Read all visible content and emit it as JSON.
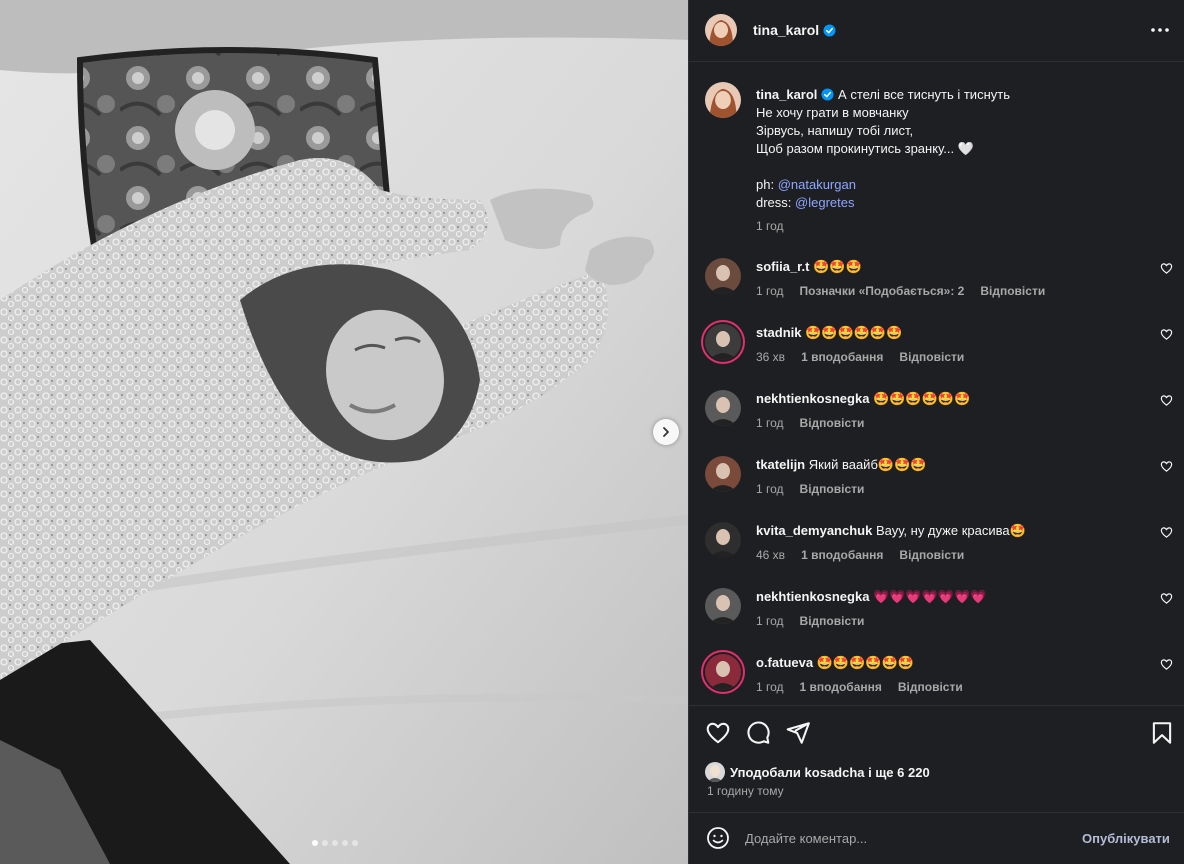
{
  "post": {
    "author": "tina_karol",
    "caption_lines": [
      "А стелі все тиснуть і тиснуть",
      "Не хочу грати в мовчанку",
      "Зірвусь, напишу тобі лист,",
      "Щоб разом прокинутись зранку... 🤍"
    ],
    "credit_ph_label": "ph:",
    "credit_ph_handle": "@natakurgan",
    "credit_dress_label": "dress:",
    "credit_dress_handle": "@legretes",
    "caption_time": "1 год",
    "likes_text": "Уподобали kosadcha і ще 6 220",
    "posted": "1 годину тому",
    "slide_count": 5,
    "active_slide": 1
  },
  "comments": [
    {
      "user": "sofiia_r.t",
      "text": "🤩🤩🤩",
      "time": "1 год",
      "likes": "Позначки «Подобається»: 2",
      "reply": "Відповісти"
    },
    {
      "user": "stadnik",
      "text": "🤩🤩🤩🤩🤩🤩",
      "time": "36 хв",
      "likes": "1 вподобання",
      "reply": "Відповісти"
    },
    {
      "user": "nekhtienkosnegka",
      "text": "🤩🤩🤩🤩🤩🤩",
      "time": "1 год",
      "likes": "",
      "reply": "Відповісти"
    },
    {
      "user": "tkatelijn",
      "text": "Який ваайб🤩🤩🤩",
      "time": "1 год",
      "likes": "",
      "reply": "Відповісти"
    },
    {
      "user": "kvita_demyanchuk",
      "text": "Вауу, ну дуже красива🤩",
      "time": "46 хв",
      "likes": "1 вподобання",
      "reply": "Відповісти"
    },
    {
      "user": "nekhtienkosnegka",
      "text": "💗💗💗💗💗💗💗",
      "time": "1 год",
      "likes": "",
      "reply": "Відповісти"
    },
    {
      "user": "o.fatueva",
      "text": "🤩🤩🤩🤩🤩🤩",
      "time": "1 год",
      "likes": "1 вподобання",
      "reply": "Відповісти"
    }
  ],
  "comment_box": {
    "placeholder": "Додайте коментар...",
    "publish_label": "Опублікувати"
  },
  "icons": {
    "verified": "verified-badge-icon",
    "more": "more-options-icon",
    "next": "chevron-right-icon",
    "like": "heart-icon",
    "comment": "comment-icon",
    "share": "share-icon",
    "save": "bookmark-icon",
    "emoji": "emoji-icon"
  },
  "colors": {
    "panel_bg": "#1e1f22",
    "mention": "#8ea7ff",
    "verified": "#0095f6",
    "muted_text": "#a8a8a8"
  }
}
